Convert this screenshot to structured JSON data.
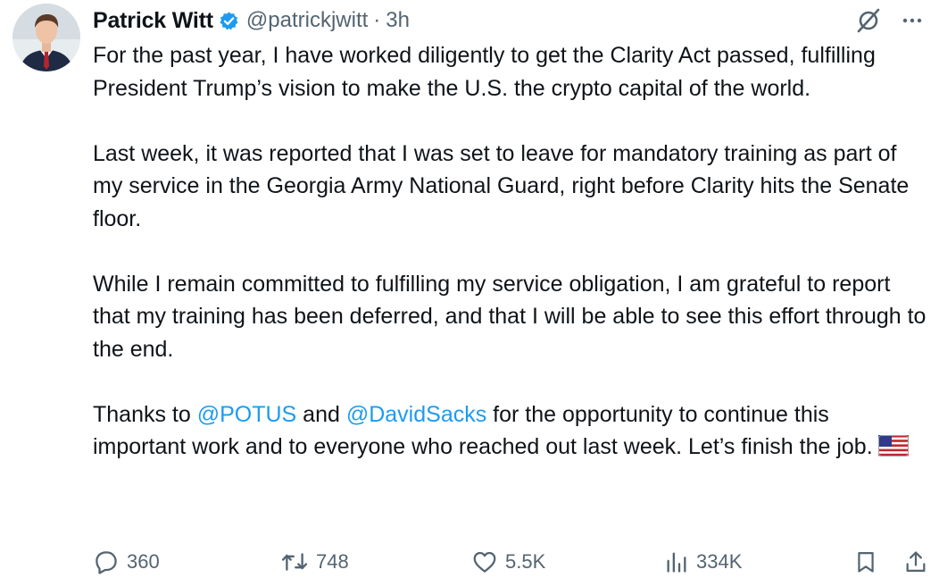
{
  "author": {
    "display_name": "Patrick Witt",
    "handle": "@patrickjwitt",
    "separator": "·",
    "time": "3h"
  },
  "icons": {
    "verified": "verified-badge-icon",
    "grok": "grok-icon",
    "more": "more-icon",
    "reply": "reply-icon",
    "retweet": "retweet-icon",
    "like": "like-icon",
    "views": "views-icon",
    "bookmark": "bookmark-icon",
    "share": "share-icon",
    "flag": "us-flag-emoji"
  },
  "tweet": {
    "paragraph_1": "For the past year, I have worked diligently to get the Clarity Act passed, fulfilling President Trump’s vision to make the U.S. the crypto capital of the world.",
    "paragraph_2": "Last week, it was reported that I was set to leave for mandatory training as part of my service in the Georgia Army National Guard, right before Clarity hits the Senate floor.",
    "paragraph_3": "While I remain committed to fulfilling my service obligation, I am grateful to report that my training has been deferred, and that I will be able to see this effort through to the end.",
    "paragraph_4": {
      "part_1": "Thanks to ",
      "mention_1": "@POTUS",
      "part_2": " and ",
      "mention_2": "@DavidSacks",
      "part_3": " for the opportunity to continue this important work and to everyone who reached out last week. Let’s finish the job."
    }
  },
  "metrics": {
    "replies": "360",
    "reposts": "748",
    "likes": "5.5K",
    "views": "334K"
  },
  "colors": {
    "text": "#0f1419",
    "secondary": "#536471",
    "link": "#1d9bf0",
    "verified": "#1d9bf0"
  }
}
